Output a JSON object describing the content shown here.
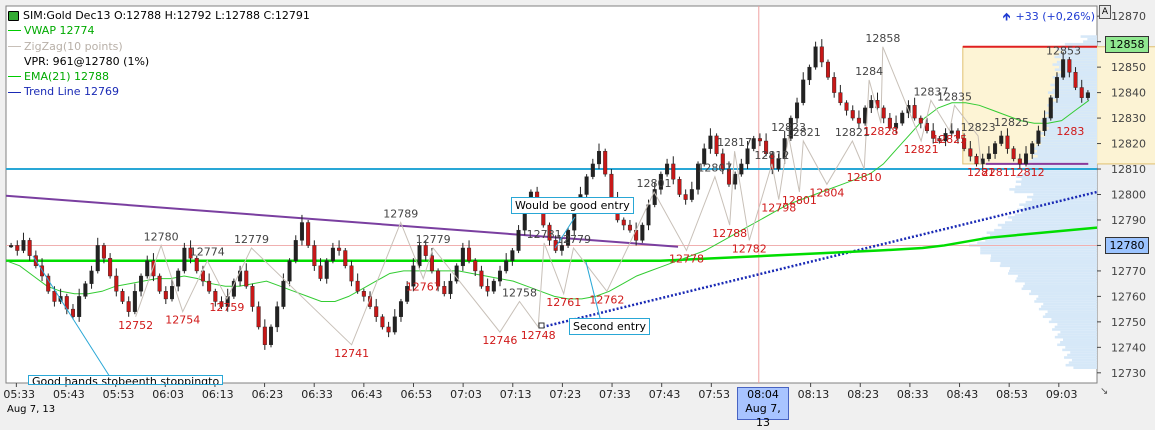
{
  "header": {
    "instrument": "SIM:Gold Dec13",
    "ohlc": "O:12788 H:12792 L:12788 C:12791"
  },
  "legend": [
    {
      "label": "VWAP  12774",
      "color": "#00cc00"
    },
    {
      "label": "ZigZag(10 points)",
      "color": "#c8c0b8"
    },
    {
      "label": "VPR: 961@12780 (1%)",
      "color": "#000000"
    },
    {
      "label": "EMA(21)  12788",
      "color": "#00cc00"
    },
    {
      "label": "Trend Line  12769",
      "color": "#1a2ab5"
    }
  ],
  "performance": {
    "arrow": "up-arrow-icon",
    "text": "+33 (+0,26%)"
  },
  "price_badges": {
    "upper": "12858",
    "lower": "12780",
    "upper_color": "#90e890",
    "lower_color": "#9cc4ff"
  },
  "annotations": {
    "good_entry": "Would be good entry",
    "second_entry": "Second entry",
    "bottom_note": "Good hands stobeenth stoppingto"
  },
  "time_cursor": {
    "time": "08:04",
    "date": "Aug 7, 13"
  },
  "date_label": "Aug 7, 13",
  "chart_data": {
    "type": "candlestick",
    "ylim": [
      12726,
      12874
    ],
    "y_ticks": [
      "12870",
      "12860",
      "12850",
      "12840",
      "12830",
      "12820",
      "12810",
      "12800",
      "12790",
      "12780",
      "12770",
      "12760",
      "12750",
      "12740",
      "12730"
    ],
    "x_ticks": [
      "05:33",
      "05:43",
      "05:53",
      "06:03",
      "06:13",
      "06:23",
      "06:33",
      "06:43",
      "06:53",
      "07:03",
      "07:13",
      "07:23",
      "07:33",
      "07:43",
      "07:53",
      "08:13",
      "08:23",
      "08:33",
      "08:43",
      "08:53",
      "09:03"
    ],
    "close_path": [
      12780,
      12778,
      12782,
      12776,
      12772,
      12768,
      12762,
      12758,
      12760,
      12755,
      12752,
      12760,
      12765,
      12770,
      12780,
      12775,
      12768,
      12762,
      12758,
      12754,
      12762,
      12768,
      12774,
      12768,
      12762,
      12759,
      12764,
      12770,
      12779,
      12775,
      12770,
      12766,
      12762,
      12758,
      12756,
      12760,
      12766,
      12770,
      12764,
      12756,
      12748,
      12741,
      12748,
      12756,
      12766,
      12774,
      12782,
      12789,
      12780,
      12772,
      12767,
      12774,
      12779,
      12778,
      12772,
      12766,
      12762,
      12760,
      12756,
      12752,
      12748,
      12746,
      12752,
      12758,
      12764,
      12772,
      12780,
      12776,
      12770,
      12764,
      12761,
      12766,
      12772,
      12779,
      12774,
      12770,
      12764,
      12762,
      12766,
      12770,
      12774,
      12778,
      12786,
      12794,
      12801,
      12796,
      12788,
      12782,
      12778,
      12780,
      12786,
      12794,
      12800,
      12807,
      12812,
      12817,
      12808,
      12798,
      12790,
      12788,
      12786,
      12782,
      12788,
      12796,
      12802,
      12808,
      12812,
      12806,
      12800,
      12798,
      12802,
      12812,
      12818,
      12823,
      12816,
      12810,
      12804,
      12808,
      12812,
      12818,
      12822,
      12821,
      12816,
      12810,
      12814,
      12822,
      12830,
      12836,
      12845,
      12850,
      12858,
      12852,
      12846,
      12840,
      12836,
      12833,
      12830,
      12828,
      12834,
      12837,
      12834,
      12830,
      12826,
      12828,
      12832,
      12835,
      12830,
      12828,
      12825,
      12822,
      12821,
      12824,
      12825,
      12822,
      12818,
      12815,
      12812,
      12814,
      12816,
      12820,
      12823,
      12818,
      12814,
      12812,
      12816,
      12820,
      12825,
      12830,
      12838,
      12846,
      12853,
      12848,
      12842,
      12838,
      12840
    ],
    "ema21": [
      12774,
      12772,
      12768,
      12764,
      12762,
      12761,
      12761,
      12762,
      12764,
      12765,
      12766,
      12767,
      12767,
      12768,
      12767,
      12765,
      12764,
      12764,
      12765,
      12766,
      12764,
      12762,
      12760,
      12758,
      12758,
      12760,
      12763,
      12766,
      12769,
      12770,
      12770,
      12770,
      12770,
      12770,
      12769,
      12768,
      12767,
      12766,
      12764,
      12762,
      12760,
      12759,
      12759,
      12760,
      12762,
      12765,
      12768,
      12770,
      12772,
      12774,
      12776,
      12778,
      12781,
      12784,
      12787,
      12790,
      12793,
      12796,
      12798,
      12800,
      12802,
      12804,
      12806,
      12808,
      12812,
      12818,
      12824,
      12830,
      12834,
      12836,
      12836,
      12835,
      12833,
      12831,
      12829,
      12828,
      12828,
      12829,
      12833,
      12837
    ],
    "vwap_level": 12774,
    "vpr_level": 12780,
    "support_level": 12810,
    "resistance_level": 12858,
    "range_bottom": 12812,
    "swing_labels": [
      {
        "text": "12780",
        "x": 0.158,
        "y": 12780,
        "kind": "high"
      },
      {
        "text": "12774",
        "x": 0.205,
        "y": 12774,
        "kind": "high"
      },
      {
        "text": "12779",
        "x": 0.25,
        "y": 12779,
        "kind": "high"
      },
      {
        "text": "12752",
        "x": 0.132,
        "y": 12752,
        "kind": "low"
      },
      {
        "text": "12754",
        "x": 0.18,
        "y": 12754,
        "kind": "low"
      },
      {
        "text": "12759",
        "x": 0.225,
        "y": 12759,
        "kind": "low"
      },
      {
        "text": "12741",
        "x": 0.352,
        "y": 12741,
        "kind": "low"
      },
      {
        "text": "12789",
        "x": 0.402,
        "y": 12789,
        "kind": "high"
      },
      {
        "text": "12779",
        "x": 0.435,
        "y": 12779,
        "kind": "high"
      },
      {
        "text": "12767",
        "x": 0.425,
        "y": 12767,
        "kind": "low"
      },
      {
        "text": "12746",
        "x": 0.503,
        "y": 12746,
        "kind": "low"
      },
      {
        "text": "12758",
        "x": 0.523,
        "y": 12758,
        "kind": "high"
      },
      {
        "text": "12748",
        "x": 0.542,
        "y": 12748,
        "kind": "low"
      },
      {
        "text": "12781",
        "x": 0.548,
        "y": 12781,
        "kind": "high"
      },
      {
        "text": "12779",
        "x": 0.578,
        "y": 12779,
        "kind": "high"
      },
      {
        "text": "12761",
        "x": 0.568,
        "y": 12761,
        "kind": "low"
      },
      {
        "text": "12762",
        "x": 0.612,
        "y": 12762,
        "kind": "low"
      },
      {
        "text": "12801",
        "x": 0.66,
        "y": 12801,
        "kind": "high"
      },
      {
        "text": "12778",
        "x": 0.693,
        "y": 12778,
        "kind": "low"
      },
      {
        "text": "12807",
        "x": 0.722,
        "y": 12807,
        "kind": "high"
      },
      {
        "text": "12817",
        "x": 0.742,
        "y": 12817,
        "kind": "high"
      },
      {
        "text": "12788",
        "x": 0.737,
        "y": 12788,
        "kind": "low"
      },
      {
        "text": "12782",
        "x": 0.757,
        "y": 12782,
        "kind": "low"
      },
      {
        "text": "12812",
        "x": 0.78,
        "y": 12812,
        "kind": "high"
      },
      {
        "text": "12823",
        "x": 0.797,
        "y": 12823,
        "kind": "high"
      },
      {
        "text": "12821",
        "x": 0.812,
        "y": 12821,
        "kind": "high"
      },
      {
        "text": "12798",
        "x": 0.787,
        "y": 12798,
        "kind": "low"
      },
      {
        "text": "12801",
        "x": 0.808,
        "y": 12801,
        "kind": "low"
      },
      {
        "text": "12804",
        "x": 0.836,
        "y": 12804,
        "kind": "low"
      },
      {
        "text": "12821",
        "x": 0.862,
        "y": 12821,
        "kind": "high"
      },
      {
        "text": "12810",
        "x": 0.874,
        "y": 12810,
        "kind": "low"
      },
      {
        "text": "12858",
        "x": 0.893,
        "y": 12858,
        "kind": "high"
      },
      {
        "text": "1284",
        "x": 0.879,
        "y": 12845,
        "kind": "high"
      },
      {
        "text": "12828",
        "x": 0.891,
        "y": 12828,
        "kind": "low"
      },
      {
        "text": "12837",
        "x": 0.942,
        "y": 12837,
        "kind": "high"
      },
      {
        "text": "12835",
        "x": 0.966,
        "y": 12835,
        "kind": "high"
      },
      {
        "text": "12821",
        "x": 0.932,
        "y": 12821,
        "kind": "low"
      },
      {
        "text": "12825",
        "x": 0.961,
        "y": 12825,
        "kind": "low"
      },
      {
        "text": "12823",
        "x": 0.99,
        "y": 12823,
        "kind": "high"
      },
      {
        "text": "12825",
        "x": 1.024,
        "y": 12825,
        "kind": "high"
      },
      {
        "text": "12853",
        "x": 1.077,
        "y": 12853,
        "kind": "high"
      },
      {
        "text": "1283",
        "x": 1.084,
        "y": 12828,
        "kind": "low"
      },
      {
        "text": "1281",
        "x": 0.993,
        "y": 12812,
        "kind": "low"
      },
      {
        "text": "2281",
        "x": 1.008,
        "y": 12812,
        "kind": "low"
      },
      {
        "text": "12812",
        "x": 1.04,
        "y": 12812,
        "kind": "low"
      }
    ]
  }
}
